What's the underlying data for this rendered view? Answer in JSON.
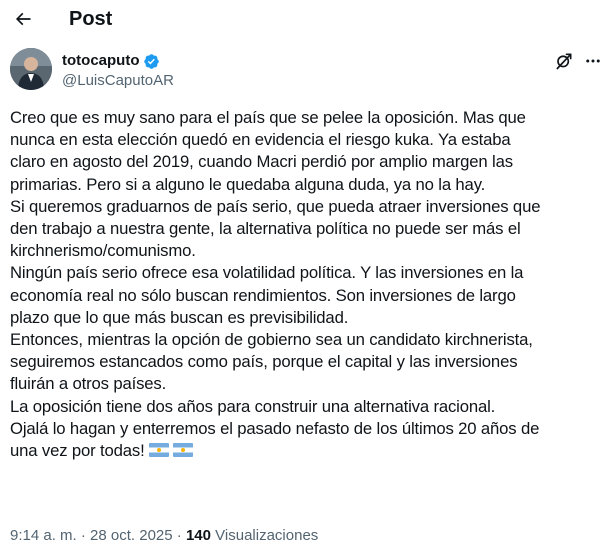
{
  "header": {
    "title": "Post",
    "back_icon": "arrow-left-icon"
  },
  "author": {
    "name": "totocaputo",
    "handle": "@LuisCaputoAR",
    "verified": true,
    "verified_color": "#1d9bf0"
  },
  "actions": {
    "grok_icon": "grok-icon",
    "more_icon": "more-icon"
  },
  "tweet": {
    "lines": [
      "Creo que es muy sano para el país que se pelee la oposición. Mas que",
      "nunca en esta elección quedó en evidencia el riesgo kuka. Ya estaba",
      "claro en agosto del 2019, cuando Macri perdió por amplio margen las",
      "primarias. Pero si a alguno le quedaba alguna duda, ya no la hay.",
      "Si queremos graduarnos de país serio, que pueda atraer inversiones que",
      "den trabajo a nuestra gente, la alternativa política no puede ser más el",
      "kirchnerismo/comunismo.",
      "Ningún país serio ofrece esa volatilidad política. Y las inversiones en la",
      "economía real no sólo buscan rendimientos. Son inversiones de largo",
      "plazo que lo que más buscan es previsibilidad.",
      "Entonces, mientras la opción de gobierno sea un candidato kirchnerista,",
      "seguiremos estancados como país, porque el capital y las inversiones",
      "fluirán a otros países.",
      "La oposición tiene dos años para construir una alternativa racional.",
      "Ojalá lo hagan y enterremos el pasado nefasto de los últimos 20 años de",
      "una vez por todas!"
    ],
    "emoji": [
      "flag-argentina-icon",
      "flag-argentina-icon"
    ]
  },
  "meta": {
    "time": "9:14 a. m.",
    "separator": "·",
    "date": "28 oct. 2025",
    "views_count": "140",
    "views_label": "Visualizaciones"
  },
  "colors": {
    "text": "#0f1419",
    "secondary": "#536471",
    "accent": "#1d9bf0",
    "background": "#ffffff"
  }
}
